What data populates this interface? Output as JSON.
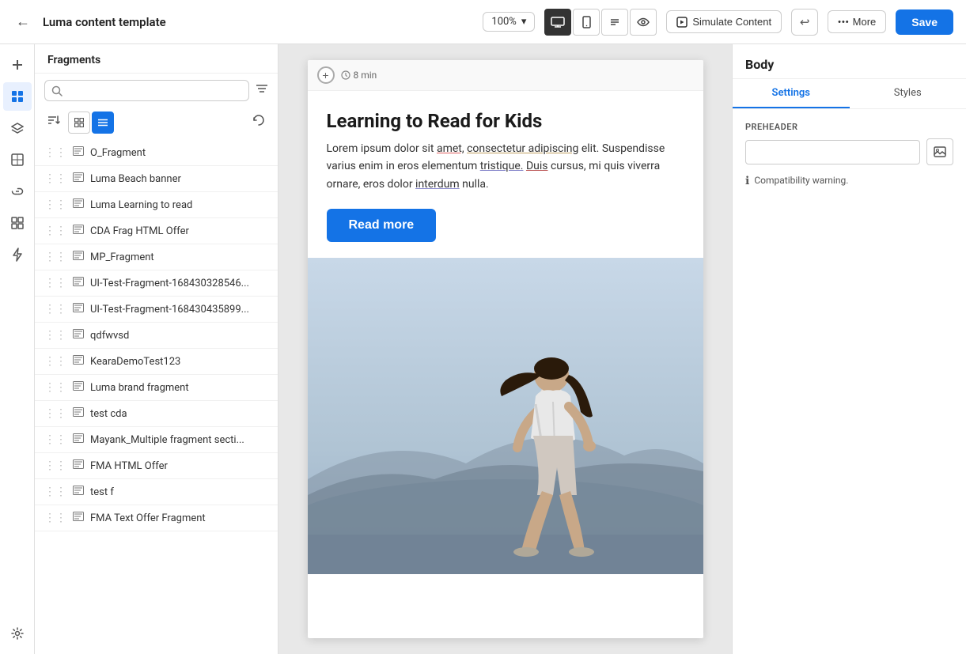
{
  "topbar": {
    "back_icon": "←",
    "title": "Luma content template",
    "zoom_label": "100%",
    "zoom_chevron": "▾",
    "desktop_icon": "🖥",
    "mobile_icon": "📱",
    "text_icon": "T",
    "eye_icon": "👁",
    "simulate_icon": "▶",
    "simulate_label": "Simulate Content",
    "undo_icon": "↩",
    "more_dots": "•••",
    "more_label": "More",
    "save_label": "Save"
  },
  "icon_bar": {
    "icons": [
      {
        "name": "add-icon",
        "symbol": "+",
        "active": false
      },
      {
        "name": "fragments-icon",
        "symbol": "⊞",
        "active": true
      },
      {
        "name": "layers-icon",
        "symbol": "◧",
        "active": false
      },
      {
        "name": "components-icon",
        "symbol": "⊠",
        "active": false
      },
      {
        "name": "links-icon",
        "symbol": "🔗",
        "active": false
      },
      {
        "name": "grid-icon",
        "symbol": "⊟",
        "active": false
      },
      {
        "name": "lightning-icon",
        "symbol": "⚡",
        "active": false
      }
    ],
    "bottom_icons": [
      {
        "name": "settings-bottom-icon",
        "symbol": "⊙",
        "active": false
      }
    ]
  },
  "sidebar": {
    "title": "Fragments",
    "search_placeholder": "",
    "filter_icon": "▼",
    "sort_icon": "≡↑",
    "grid_view_icon": "⊞",
    "list_view_icon": "☰",
    "refresh_icon": "↻",
    "fragments": [
      {
        "name": "O_Fragment"
      },
      {
        "name": "Luma Beach banner"
      },
      {
        "name": "Luma Learning to read"
      },
      {
        "name": "CDA Frag HTML Offer"
      },
      {
        "name": "MP_Fragment"
      },
      {
        "name": "UI-Test-Fragment-168430328546..."
      },
      {
        "name": "UI-Test-Fragment-168430435899..."
      },
      {
        "name": "qdfwvsd"
      },
      {
        "name": "KearaDemoTest123"
      },
      {
        "name": "Luma brand fragment"
      },
      {
        "name": "test cda"
      },
      {
        "name": "Mayank_Multiple fragment secti..."
      },
      {
        "name": "FMA HTML Offer"
      },
      {
        "name": "test f"
      },
      {
        "name": "FMA Text Offer Fragment"
      }
    ]
  },
  "canvas": {
    "add_btn_icon": "+",
    "time_icon": "🕐",
    "time_label": "8 min",
    "article_title": "Learning to Read for Kids",
    "article_body_1": "Lorem ipsum dolor sit ",
    "article_link1": "amet,",
    "article_body_2": " consectetur adipiscing",
    "article_link2": " elit. Suspendisse varius enim in eros elementum ",
    "article_link3": "tristique.",
    "article_body_3": " Duis cursus, mi quis viverra ornare, eros dolor ",
    "article_link4": "interdum",
    "article_body_4": " nulla.",
    "read_more_label": "Read more"
  },
  "right_panel": {
    "title": "Body",
    "tab_settings": "Settings",
    "tab_styles": "Styles",
    "preheader_label": "PREHEADER",
    "preheader_value": "",
    "preheader_placeholder": "",
    "img_icon": "🖼",
    "warning_icon": "ℹ",
    "warning_text": "Compatibility warning."
  }
}
